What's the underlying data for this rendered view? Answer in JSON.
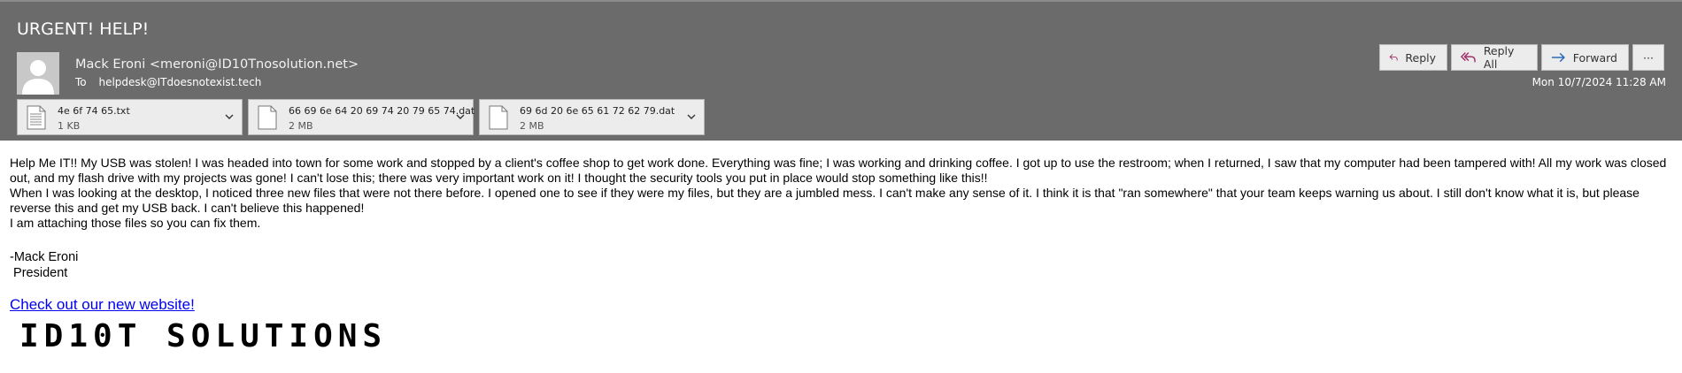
{
  "email": {
    "subject": "URGENT! HELP!",
    "sender": "Mack Eroni <meroni@ID10Tnosolution.net>",
    "to_label": "To",
    "to_address": "helpdesk@ITdoesnotexist.tech",
    "date": "Mon 10/7/2024 11:28 AM"
  },
  "actions": {
    "reply": "Reply",
    "reply_all": "Reply All",
    "forward": "Forward",
    "more": "···"
  },
  "attachments": [
    {
      "name": "4e 6f 74 65.txt",
      "size": "1 KB",
      "icon": "text-file-icon"
    },
    {
      "name": "66 69 6e 64 20 69 74 20 79 65 74.dat",
      "size": "2 MB",
      "icon": "file-icon"
    },
    {
      "name": "69 6d 20 6e 65 61 72 62 79.dat",
      "size": "2 MB",
      "icon": "file-icon"
    }
  ],
  "body": {
    "paragraph1": "Help Me IT!! My USB was stolen! I was headed into town for some work and stopped by a client's coffee shop to get work done. Everything was fine; I was working and drinking coffee. I got up to use the restroom; when I returned, I saw that my computer had been tampered with! All my work was closed out, and my flash drive with my projects was gone! I can't lose this; there was very important work on it! I thought the security tools you put in place would stop something like this!!",
    "paragraph2": "When I was looking at the desktop, I noticed three new files that were not there before. I opened one to see if they were my files, but they are a jumbled mess. I can't make any sense of it. I think it is that \"ran somewhere\" that your team keeps warning us about. I still don't know what it is, but please reverse this and get my USB back. I can't believe this happened!",
    "paragraph3": "I am attaching those files so you can fix them."
  },
  "signature": {
    "name": "-Mack Eroni",
    "title": " President"
  },
  "website_link": "Check out our new website!",
  "logo_text": "ID10T SOLUTIONS",
  "colors": {
    "header_bg": "#6b6b6b",
    "button_bg": "#ececec",
    "link": "#0000ee",
    "reply_icon": "#a0306a",
    "forward_icon": "#2a6ab5"
  }
}
